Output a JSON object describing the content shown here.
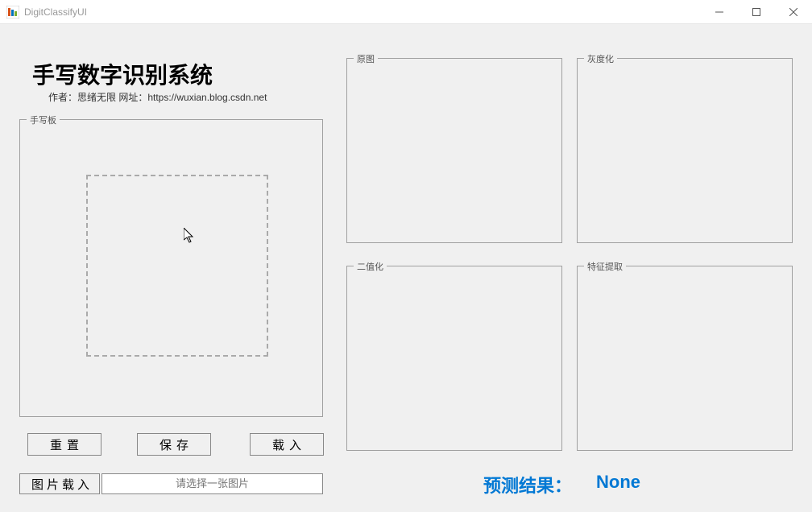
{
  "window": {
    "title": "DigitClassifyUI"
  },
  "header": {
    "title": "手写数字识别系统",
    "subtitle": "作者：思绪无限 网址：https://wuxian.blog.csdn.net"
  },
  "panels": {
    "draw": "手写板",
    "original": "原图",
    "grayscale": "灰度化",
    "binarize": "二值化",
    "feature": "特征提取"
  },
  "buttons": {
    "reset": "重置",
    "save": "保存",
    "load": "载入",
    "image_load": "图片载入"
  },
  "input": {
    "placeholder": "请选择一张图片",
    "value": ""
  },
  "result": {
    "label": "预测结果：",
    "value": "None"
  }
}
